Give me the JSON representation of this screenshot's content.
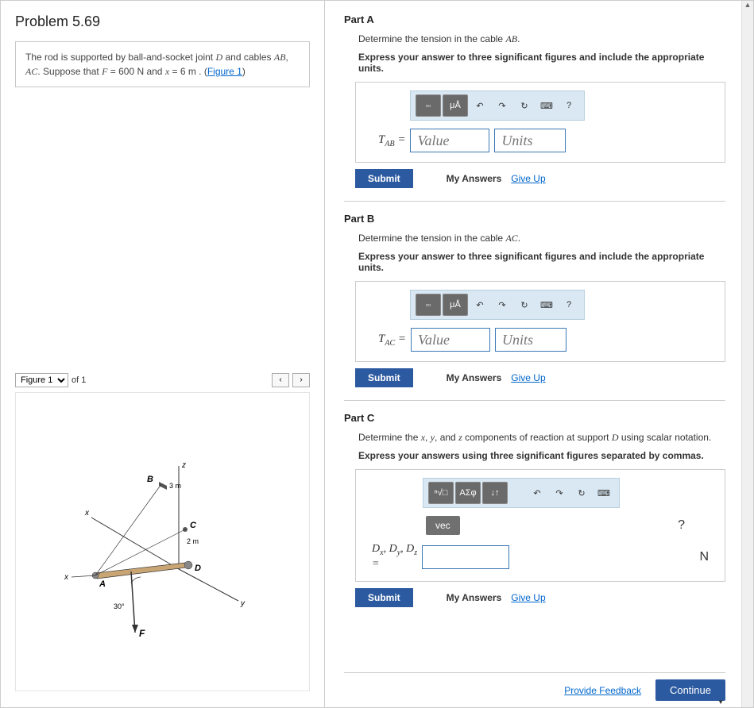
{
  "problem": {
    "title": "Problem 5.69",
    "text_prefix": "The rod is supported by ball-and-socket joint ",
    "var_D": "D",
    "text_mid1": " and cables ",
    "var_AB": "AB",
    "text_mid2": ", ",
    "var_AC": "AC",
    "text_mid3": ". Suppose that ",
    "var_F": "F",
    "eq_F": " = 600  N ",
    "text_mid4": " and ",
    "var_x": "x",
    "eq_x": " = 6 ",
    "unit_m": "m",
    "text_end": " . (",
    "figure_link": "Figure 1",
    "text_close": ")"
  },
  "figure": {
    "select_label": "Figure 1",
    "of_label": "of 1",
    "prev": "‹",
    "next": "›",
    "labels": {
      "z": "z",
      "x": "x",
      "y": "y",
      "A": "A",
      "B": "B",
      "C": "C",
      "D": "D",
      "F": "F",
      "d3m": "3 m",
      "d2m": "2 m",
      "ang": "30°"
    }
  },
  "parts": {
    "a": {
      "title": "Part A",
      "prompt_pre": "Determine the tension in the cable ",
      "prompt_var": "AB",
      "prompt_post": ".",
      "instr": "Express your answer to three significant figures and include the appropriate units.",
      "label_pre": "T",
      "label_sub": "AB",
      "label_post": " = ",
      "value_ph": "Value",
      "units_ph": "Units"
    },
    "b": {
      "title": "Part B",
      "prompt_pre": "Determine the tension in the cable ",
      "prompt_var": "AC",
      "prompt_post": ".",
      "instr": "Express your answer to three significant figures and include the appropriate units.",
      "label_pre": "T",
      "label_sub": "AC",
      "label_post": " = ",
      "value_ph": "Value",
      "units_ph": "Units"
    },
    "c": {
      "title": "Part C",
      "prompt_pre": "Determine the ",
      "vx": "x",
      "c1": ", ",
      "vy": "y",
      "c2": ", and ",
      "vz": "z",
      "prompt_mid": " components of reaction at support ",
      "vD": "D",
      "prompt_post": " using scalar notation.",
      "instr": "Express your answers using three significant figures separated by commas.",
      "label_line": "Dₓ, D_y, D_z =",
      "label_Dx_pre": "D",
      "label_Dx_sub": "x",
      "label_Dy_pre": "D",
      "label_Dy_sub": "y",
      "label_Dz_pre": "D",
      "label_Dz_sub": "z",
      "eq": "=",
      "unit": "N",
      "vec_label": "vec"
    }
  },
  "toolbar": {
    "templates_tip": "templates",
    "mu_angstrom": "μÅ",
    "undo": "↶",
    "redo": "↷",
    "reset": "↻",
    "keyboard": "⌨",
    "help": "?",
    "root": "ⁿ√□",
    "greek": "ΑΣφ",
    "sort": "↓↑"
  },
  "actions": {
    "submit": "Submit",
    "my_answers": "My Answers",
    "give_up": "Give Up",
    "provide_feedback": "Provide Feedback",
    "continue": "Continue"
  }
}
